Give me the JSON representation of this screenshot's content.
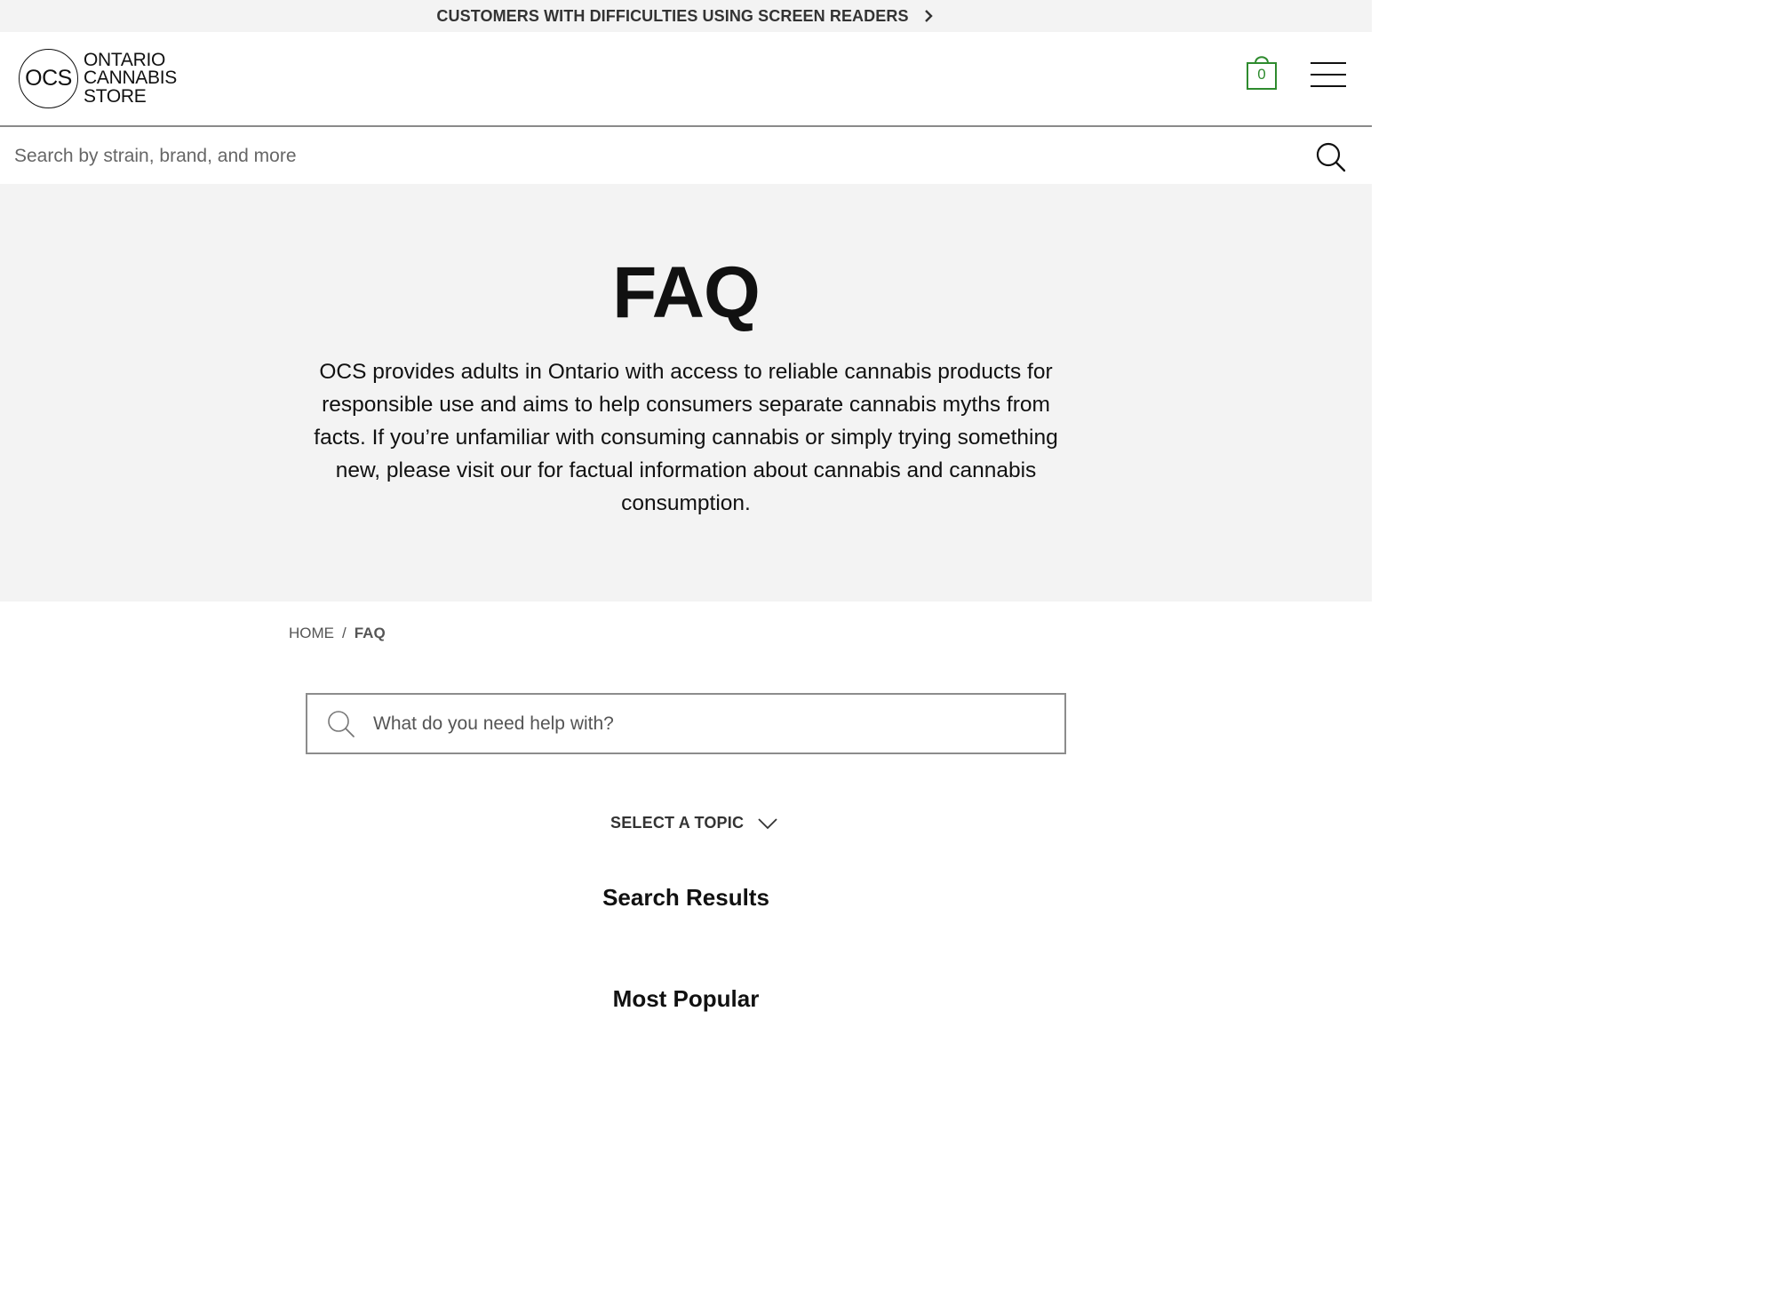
{
  "banner": {
    "text": "CUSTOMERS WITH DIFFICULTIES USING SCREEN READERS"
  },
  "logo": {
    "mark": "OCS",
    "line1": "ONTARIO",
    "line2": "CANNABIS",
    "line3": "STORE"
  },
  "cart": {
    "count": "0",
    "accent_color": "#2e8b2e"
  },
  "site_search": {
    "placeholder": "Search by strain, brand, and more"
  },
  "hero": {
    "title": "FAQ",
    "description": "OCS provides adults in Ontario with access to reliable cannabis products for responsible use and aims to help consumers separate cannabis myths from facts. If you’re unfamiliar with consuming cannabis or simply trying something new, please visit our for factual information about cannabis and cannabis consumption."
  },
  "breadcrumb": {
    "home": "HOME",
    "separator": "/",
    "current": "FAQ"
  },
  "faq_search": {
    "placeholder": "What do you need help with?"
  },
  "topic_select": {
    "label": "SELECT A TOPIC"
  },
  "sections": {
    "results": "Search Results",
    "popular": "Most Popular"
  }
}
